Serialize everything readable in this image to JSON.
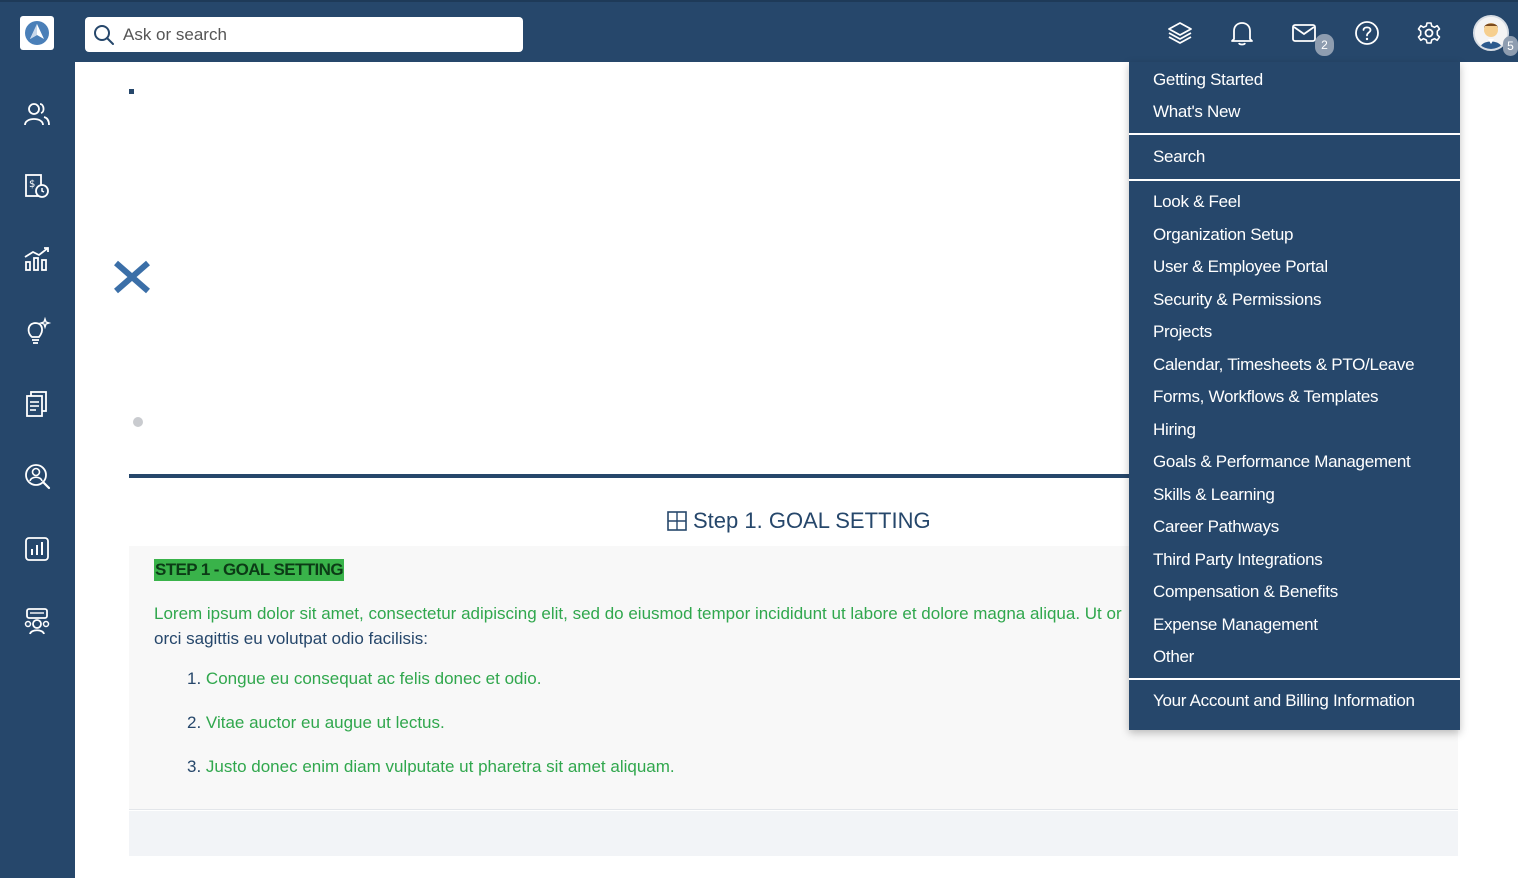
{
  "header": {
    "search_placeholder": "Ask or search",
    "mail_badge": "2",
    "avatar_badge": "5"
  },
  "sidebar": {
    "icons": [
      "people-icon",
      "expense-report-icon",
      "growth-chart-icon",
      "idea-bulb-icon",
      "documents-icon",
      "search-person-icon",
      "bar-report-icon",
      "team-chat-icon"
    ]
  },
  "content": {
    "step_title": "Step 1. GOAL SETTING",
    "highlight": "STEP 1 - GOAL SETTING",
    "lorem_main": "Lorem ipsum dolor sit amet, consectetur adipiscing elit, sed do eiusmod tempor incididunt ut labore et dolore magna aliqua. Ut or",
    "lorem_tail": "orci sagittis eu volutpat odio facilisis:",
    "list": [
      {
        "num": "1.",
        "text": "Congue eu consequat ac felis donec et odio."
      },
      {
        "num": "2.",
        "text": "Vitae auctor eu augue ut lectus."
      },
      {
        "num": "3.",
        "text": "Justo donec enim diam vulputate ut pharetra sit amet aliquam."
      }
    ]
  },
  "help_menu": {
    "group1": [
      "Getting Started",
      "What's New"
    ],
    "group2": [
      "Search"
    ],
    "group3": [
      "Look & Feel",
      "Organization Setup",
      "User & Employee Portal",
      "Security & Permissions",
      "Projects",
      "Calendar, Timesheets & PTO/Leave",
      "Forms, Workflows & Templates",
      "Hiring",
      "Goals & Performance Management",
      "Skills & Learning",
      "Career Pathways",
      "Third Party Integrations",
      "Compensation & Benefits",
      "Expense Management",
      "Other"
    ],
    "group4": [
      "Your Account and Billing Information"
    ]
  },
  "colors": {
    "navy": "#26476b",
    "green_text": "#30a74d",
    "green_highlight": "#39b34a"
  }
}
